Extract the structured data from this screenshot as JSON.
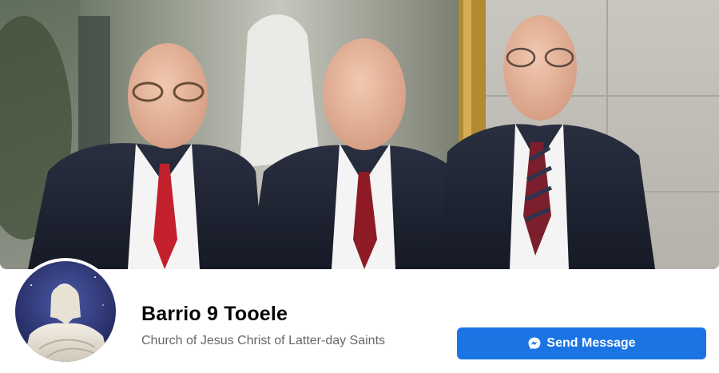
{
  "profile": {
    "name": "Barrio 9 Tooele",
    "category": "Church of Jesus Christ of Latter-day Saints"
  },
  "actions": {
    "send_message_label": "Send Message"
  },
  "icons": {
    "send_message": "messenger-icon"
  },
  "colors": {
    "primary_button": "#1b74e4",
    "name_text": "#050505",
    "category_text": "#65676b"
  }
}
